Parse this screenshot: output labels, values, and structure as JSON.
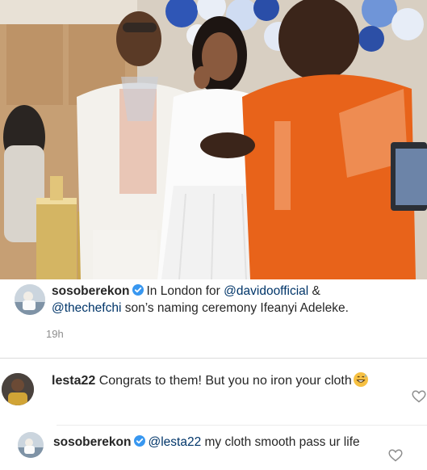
{
  "caption": {
    "username": "sosoberekon",
    "text_before": "In London for",
    "mention1": "@davidoofficial",
    "text_mid": "&",
    "mention2": "@thechefchi",
    "text_after": "son’s naming ceremony Ifeanyi Adeleke.",
    "time": "19h"
  },
  "comments": [
    {
      "username": "lesta22",
      "text": "Congrats to them! But you no iron your cloth",
      "emoji": "grinning-sweat-emoji"
    },
    {
      "username": "sosoberekon",
      "mention": "@lesta22",
      "text": "my cloth smooth pass ur life"
    }
  ],
  "colors": {
    "verified": "#3897f0",
    "mention": "#003569",
    "timestamp": "#8e8e8e",
    "orange_shirt": "#e8631a"
  }
}
